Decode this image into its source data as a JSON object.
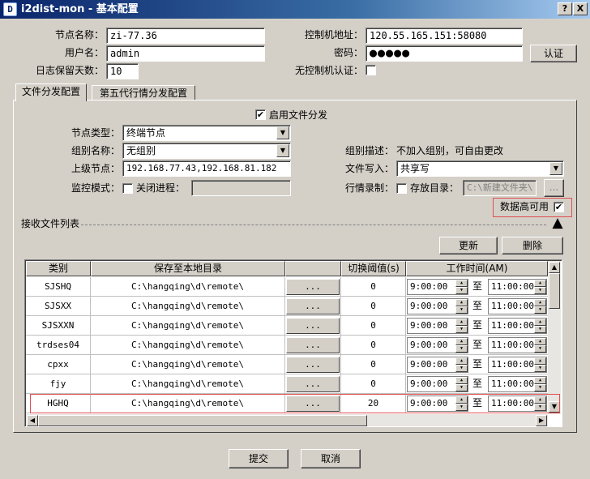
{
  "window": {
    "app_icon": "D",
    "title": "i2dist-mon - 基本配置",
    "help_label": "?",
    "close_label": "X"
  },
  "top": {
    "node_name_label": "节点名称：",
    "node_name_value": "zi-77.36",
    "user_label": "用户名：",
    "user_value": "admin",
    "log_days_label": "日志保留天数：",
    "log_days_value": "10",
    "controller_label": "控制机地址：",
    "controller_value": "120.55.165.151:58080",
    "password_label": "密码：",
    "password_value": "●●●●●",
    "auth_button": "认证",
    "no_auth_label": "无控制机认证："
  },
  "tabs": [
    {
      "label": "文件分发配置"
    },
    {
      "label": "第五代行情分发配置"
    }
  ],
  "dist": {
    "enable_label": "启用文件分发",
    "enable_checked": "✔",
    "node_type_label": "节点类型：",
    "node_type_value": "终端节点",
    "group_label": "组别名称：",
    "group_value": "无组别",
    "group_desc_label": "组别描述：",
    "group_desc_value": "不加入组别，可自由更改",
    "upper_label": "上级节点：",
    "upper_value": "192.168.77.43,192.168.81.182",
    "file_write_label": "文件写入：",
    "file_write_value": "共享写",
    "monitor_label": "监控模式：",
    "close_process_label": "关闭进程：",
    "record_label": "行情录制：",
    "store_dir_label": "存放目录：",
    "store_dir_value": "C:\\新建文件夹\\",
    "browse_label": "...",
    "ha_label": "数据高可用",
    "ha_checked": "✔"
  },
  "list": {
    "section_label": "接收文件列表",
    "update_button": "更新",
    "delete_button": "删除",
    "headers": [
      "类别",
      "保存至本地目录",
      "",
      "切换阈值(s)",
      "工作时间(AM)"
    ],
    "to_label": "至",
    "rows": [
      {
        "category": "SJSHQ",
        "dir": "C:\\hangqing\\d\\remote\\",
        "browse": "...",
        "threshold": "0",
        "start": "9:00:00",
        "end": "11:00:00"
      },
      {
        "category": "SJSXX",
        "dir": "C:\\hangqing\\d\\remote\\",
        "browse": "...",
        "threshold": "0",
        "start": "9:00:00",
        "end": "11:00:00"
      },
      {
        "category": "SJSXXN",
        "dir": "C:\\hangqing\\d\\remote\\",
        "browse": "...",
        "threshold": "0",
        "start": "9:00:00",
        "end": "11:00:00"
      },
      {
        "category": "trdses04",
        "dir": "C:\\hangqing\\d\\remote\\",
        "browse": "...",
        "threshold": "0",
        "start": "9:00:00",
        "end": "11:00:00"
      },
      {
        "category": "cpxx",
        "dir": "C:\\hangqing\\d\\remote\\",
        "browse": "...",
        "threshold": "0",
        "start": "9:00:00",
        "end": "11:00:00"
      },
      {
        "category": "fjy",
        "dir": "C:\\hangqing\\d\\remote\\",
        "browse": "...",
        "threshold": "0",
        "start": "9:00:00",
        "end": "11:00:00"
      },
      {
        "category": "HGHQ",
        "dir": "C:\\hangqing\\d\\remote\\",
        "browse": "...",
        "threshold": "20",
        "start": "9:00:00",
        "end": "11:00:00"
      }
    ]
  },
  "footer": {
    "submit_button": "提交",
    "cancel_button": "取消"
  }
}
